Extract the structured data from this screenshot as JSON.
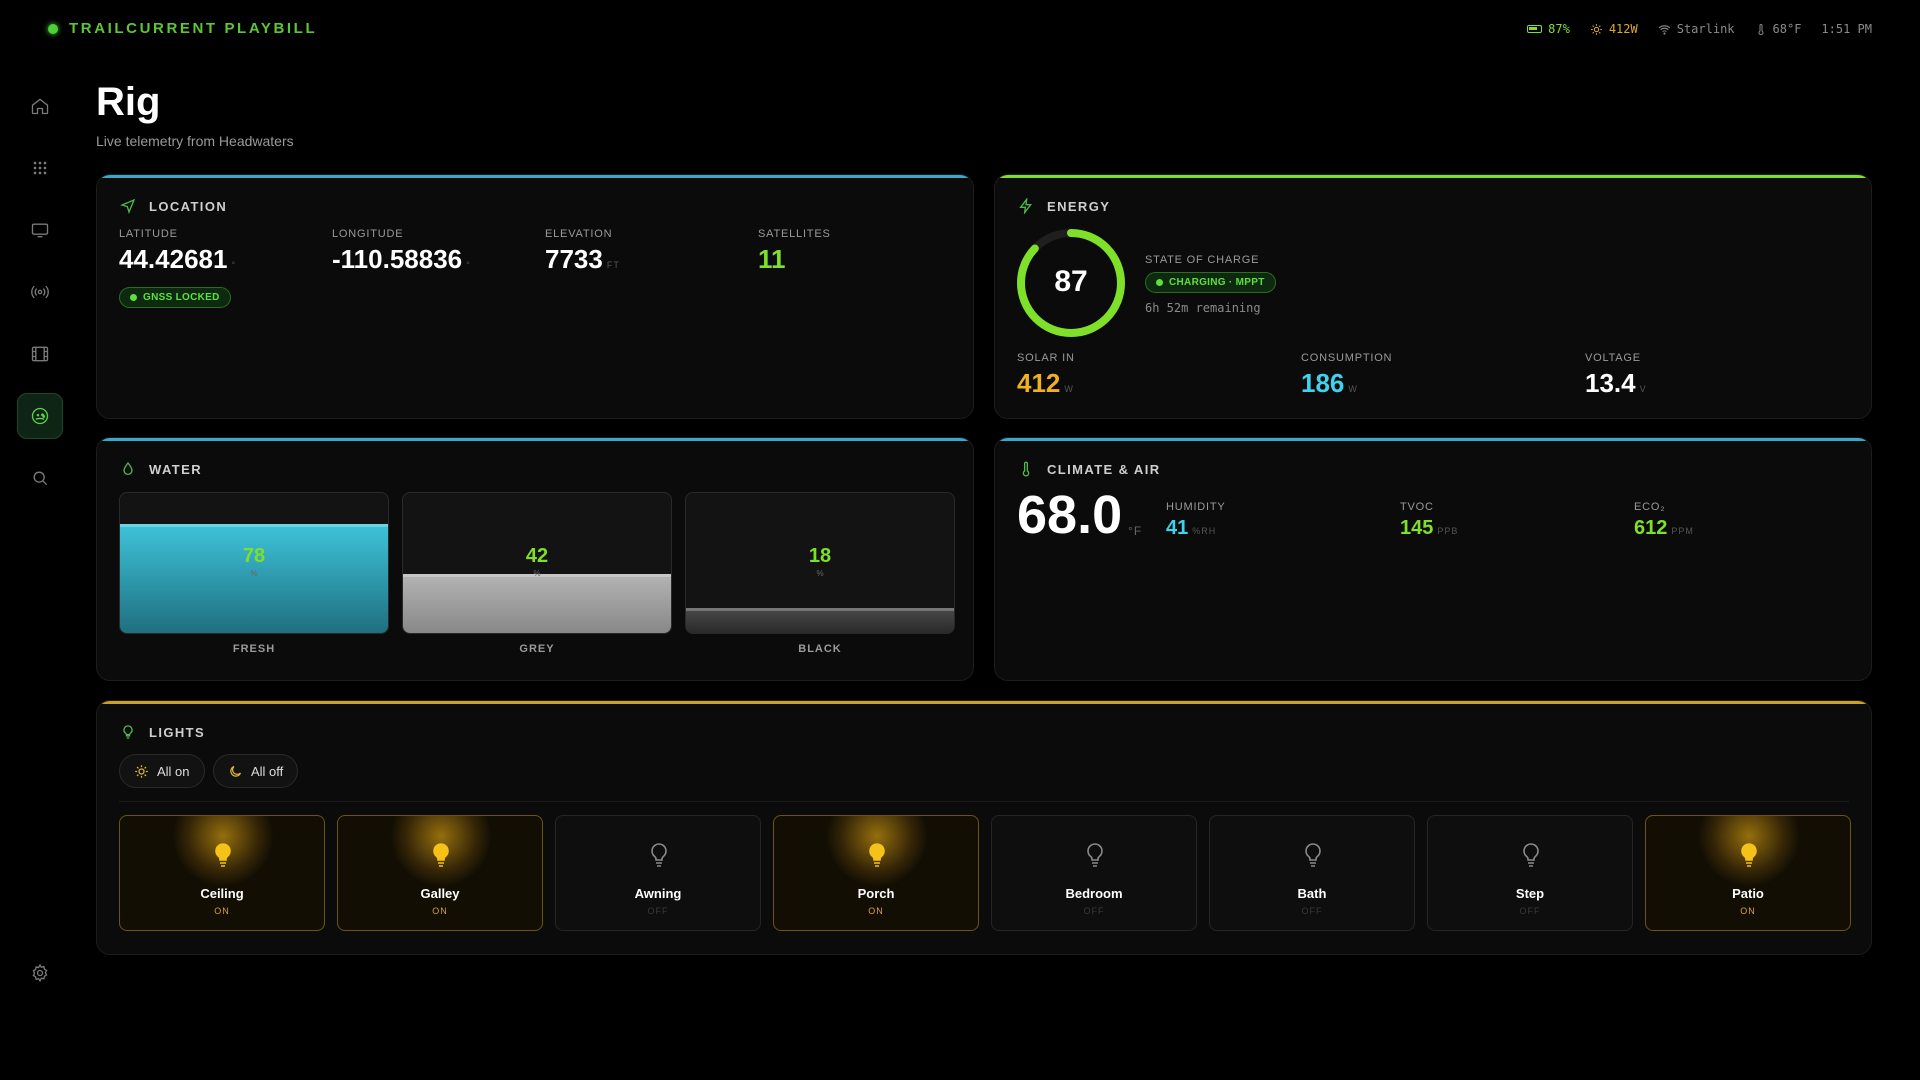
{
  "app": {
    "brand": "TRAILCURRENT PLAYBILL"
  },
  "statusbar": {
    "battery": "87%",
    "solar": "412W",
    "network": "Starlink",
    "temperature": "68°F",
    "time": "1:51 PM"
  },
  "sidebar": {
    "items": [
      {
        "icon": "home-icon"
      },
      {
        "icon": "apps-grid-icon"
      },
      {
        "icon": "display-icon"
      },
      {
        "icon": "broadcast-icon"
      },
      {
        "icon": "film-icon"
      },
      {
        "icon": "gamepad-icon",
        "active": true
      },
      {
        "icon": "search-icon"
      }
    ],
    "bottom_icon": "gear-icon"
  },
  "page": {
    "title": "Rig",
    "subtitle": "Live telemetry from Headwaters"
  },
  "location": {
    "label": "LOCATION",
    "latitude": {
      "label": "LATITUDE",
      "value": "44.42681",
      "unit": "°"
    },
    "longitude": {
      "label": "LONGITUDE",
      "value": "-110.58836",
      "unit": "°"
    },
    "elevation": {
      "label": "ELEVATION",
      "value": "7733",
      "unit": "FT"
    },
    "satellites": {
      "label": "SATELLITES",
      "value": "11"
    },
    "gnss_status": "GNSS LOCKED"
  },
  "energy": {
    "label": "ENERGY",
    "soc_value": "87",
    "soc_percent": 87,
    "soc_label": "STATE OF CHARGE",
    "charging_status": "CHARGING · MPPT",
    "remaining": "6h 52m remaining",
    "solar": {
      "label": "SOLAR IN",
      "value": "412",
      "unit": "W"
    },
    "consumption": {
      "label": "CONSUMPTION",
      "value": "186",
      "unit": "W"
    },
    "voltage": {
      "label": "VOLTAGE",
      "value": "13.4",
      "unit": "V"
    }
  },
  "water": {
    "label": "WATER",
    "tanks": [
      {
        "name": "FRESH",
        "value": "78",
        "percent": 78,
        "unit": "%"
      },
      {
        "name": "GREY",
        "value": "42",
        "percent": 42,
        "unit": "%"
      },
      {
        "name": "BLACK",
        "value": "18",
        "percent": 18,
        "unit": "%"
      }
    ]
  },
  "climate": {
    "label": "CLIMATE & AIR",
    "temperature": {
      "value": "68.0",
      "unit": "°F"
    },
    "humidity": {
      "label": "HUMIDITY",
      "value": "41",
      "unit": "%RH"
    },
    "tvoc": {
      "label": "TVOC",
      "value": "145",
      "unit": "PPB"
    },
    "eco2": {
      "label": "ECO₂",
      "value": "612",
      "unit": "PPM"
    }
  },
  "lights": {
    "label": "LIGHTS",
    "all_on_label": "All on",
    "all_off_label": "All off",
    "items": [
      {
        "name": "Ceiling",
        "state": "ON"
      },
      {
        "name": "Galley",
        "state": "ON"
      },
      {
        "name": "Awning",
        "state": "OFF"
      },
      {
        "name": "Porch",
        "state": "ON"
      },
      {
        "name": "Bedroom",
        "state": "OFF"
      },
      {
        "name": "Bath",
        "state": "OFF"
      },
      {
        "name": "Step",
        "state": "OFF"
      },
      {
        "name": "Patio",
        "state": "ON"
      }
    ]
  },
  "colors": {
    "accent_green": "#7fe02a",
    "solar_orange": "#f0b020",
    "consumption_cyan": "#3fd2ee",
    "water_accent": "#3aa8c8",
    "lights_accent": "#c9a227"
  }
}
